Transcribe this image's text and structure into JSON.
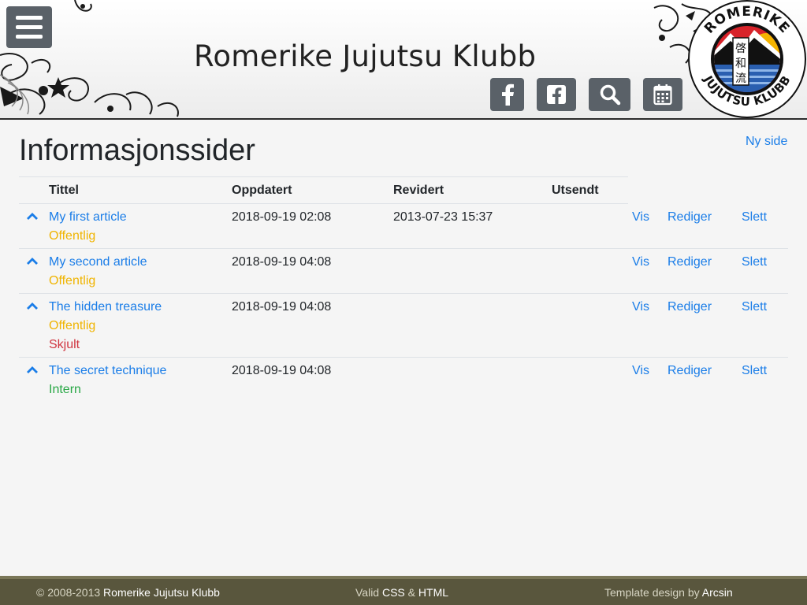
{
  "header": {
    "site_title": "Romerike Jujutsu Klubb",
    "buttons": [
      {
        "icon": "facebook-icon"
      },
      {
        "icon": "facebook-square-icon"
      },
      {
        "icon": "search-icon"
      },
      {
        "icon": "calendar-icon"
      }
    ],
    "logo": {
      "top_text": "ROMERIKE",
      "bottom_text": "JUJUTSU KLUBB",
      "kanji": [
        "啓",
        "和",
        "流"
      ]
    }
  },
  "main": {
    "title": "Informasjonssider",
    "new_page_label": "Ny side",
    "table": {
      "columns": [
        "Tittel",
        "Oppdatert",
        "Revidert",
        "Utsendt"
      ],
      "rows": [
        {
          "title": "My first article",
          "updated": "2018-09-19 02:08",
          "revised": "2013-07-23 15:37",
          "sent": "",
          "tags": [
            {
              "label": "Offentlig",
              "kind": "public"
            }
          ]
        },
        {
          "title": "My second article",
          "updated": "2018-09-19 04:08",
          "revised": "",
          "sent": "",
          "tags": [
            {
              "label": "Offentlig",
              "kind": "public"
            }
          ]
        },
        {
          "title": "The hidden treasure",
          "updated": "2018-09-19 04:08",
          "revised": "",
          "sent": "",
          "tags": [
            {
              "label": "Offentlig",
              "kind": "public"
            },
            {
              "label": "Skjult",
              "kind": "hidden"
            }
          ]
        },
        {
          "title": "The secret technique",
          "updated": "2018-09-19 04:08",
          "revised": "",
          "sent": "",
          "tags": [
            {
              "label": "Intern",
              "kind": "intern"
            }
          ]
        }
      ],
      "actions": {
        "view": "Vis",
        "edit": "Rediger",
        "delete": "Slett"
      }
    }
  },
  "footer": {
    "copyright_prefix": "© 2008-2013",
    "copyright_name": "Romerike Jujutsu Klubb",
    "valid_prefix": "Valid",
    "valid_css": "CSS",
    "valid_amp": "&",
    "valid_html": "HTML",
    "design_prefix": "Template design by",
    "design_name": "Arcsin"
  },
  "colors": {
    "link": "#1a7de8",
    "public": "#f0b400",
    "hidden": "#d0343f",
    "intern": "#28a745",
    "footer_bg": "#59563d",
    "button_bg": "#5a6168"
  }
}
